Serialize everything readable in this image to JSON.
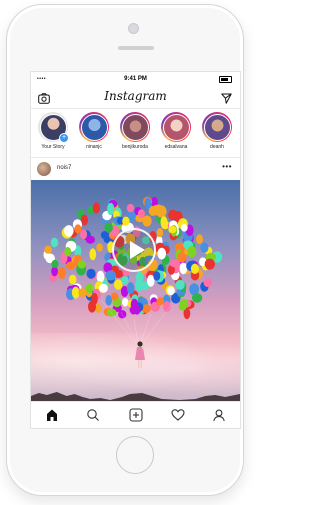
{
  "status_bar": {
    "signal": "•••• ",
    "time": "9:41 PM"
  },
  "top_bar": {
    "logo": "Instagram"
  },
  "stories": [
    {
      "name": "Your Story",
      "own": true
    },
    {
      "name": "ninanjc"
    },
    {
      "name": "benjikuroda"
    },
    {
      "name": "edsalvana"
    },
    {
      "name": "deanh"
    }
  ],
  "post": {
    "username": "nois7",
    "more": "•••"
  },
  "tab_bar": {
    "items": [
      "home-icon",
      "search-icon",
      "add-icon",
      "heart-icon",
      "profile-icon"
    ]
  },
  "colors": {
    "story_ring": "#e1306c",
    "add_badge": "#3897f0",
    "text": "#262626"
  }
}
